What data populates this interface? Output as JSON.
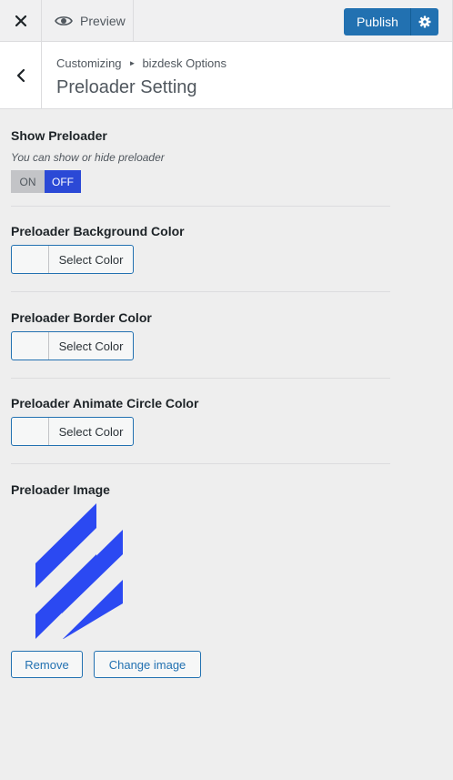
{
  "topbar": {
    "close_icon": "close-icon",
    "preview_label": "Preview",
    "publish_label": "Publish"
  },
  "header": {
    "breadcrumb_parent": "Customizing",
    "breadcrumb_child": "bizdesk Options",
    "title": "Preloader Setting"
  },
  "show_preloader": {
    "title": "Show Preloader",
    "description": "You can show or hide preloader",
    "on_label": "ON",
    "off_label": "OFF",
    "selected": "OFF"
  },
  "colors": [
    {
      "title": "Preloader Background Color",
      "button_label": "Select Color"
    },
    {
      "title": "Preloader Border Color",
      "button_label": "Select Color"
    },
    {
      "title": "Preloader Animate Circle Color",
      "button_label": "Select Color"
    }
  ],
  "preloader_image": {
    "title": "Preloader Image",
    "remove_label": "Remove",
    "change_label": "Change image",
    "logo_color": "#2b49f2"
  },
  "accent": {
    "primary": "#2271b1",
    "toggle_active": "#2b49d6"
  }
}
